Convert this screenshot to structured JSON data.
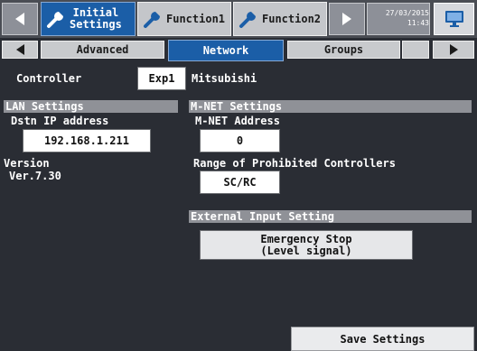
{
  "top_tabs": [
    {
      "label_line1": "Initial",
      "label_line2": "Settings",
      "icon": "wrench-icon",
      "active": true
    },
    {
      "label": "Function1",
      "icon": "wrench-icon",
      "active": false
    },
    {
      "label": "Function2",
      "icon": "wrench-icon",
      "active": false
    }
  ],
  "datetime": {
    "date": "27/03/2015",
    "time": "11:43"
  },
  "monitor_icon": "monitor-icon",
  "sub_tabs": [
    {
      "label": "Advanced",
      "active": false
    },
    {
      "label": "Network",
      "active": true
    },
    {
      "label": "Groups",
      "active": false
    }
  ],
  "controller": {
    "label": "Controller",
    "button": "Exp1",
    "name": "Mitsubishi"
  },
  "lan": {
    "heading": "LAN Settings",
    "ip_label": "Dstn IP address",
    "ip_value": "192.168.1.211",
    "version_label": "Version",
    "version_value": "Ver.7.30"
  },
  "mnet": {
    "heading": "M-NET Settings",
    "address_label": "M-NET Address",
    "address_value": "0",
    "range_label": "Range of Prohibited Controllers",
    "range_value": "SC/RC"
  },
  "external": {
    "heading": "External Input Setting",
    "value_line1": "Emergency Stop",
    "value_line2": "(Level signal)"
  },
  "save_label": "Save Settings",
  "colors": {
    "background": "#2a2d34",
    "active_tab": "#1b5ea7",
    "section_header": "#8f9197",
    "inactive_tab": "#c4c6ca"
  }
}
